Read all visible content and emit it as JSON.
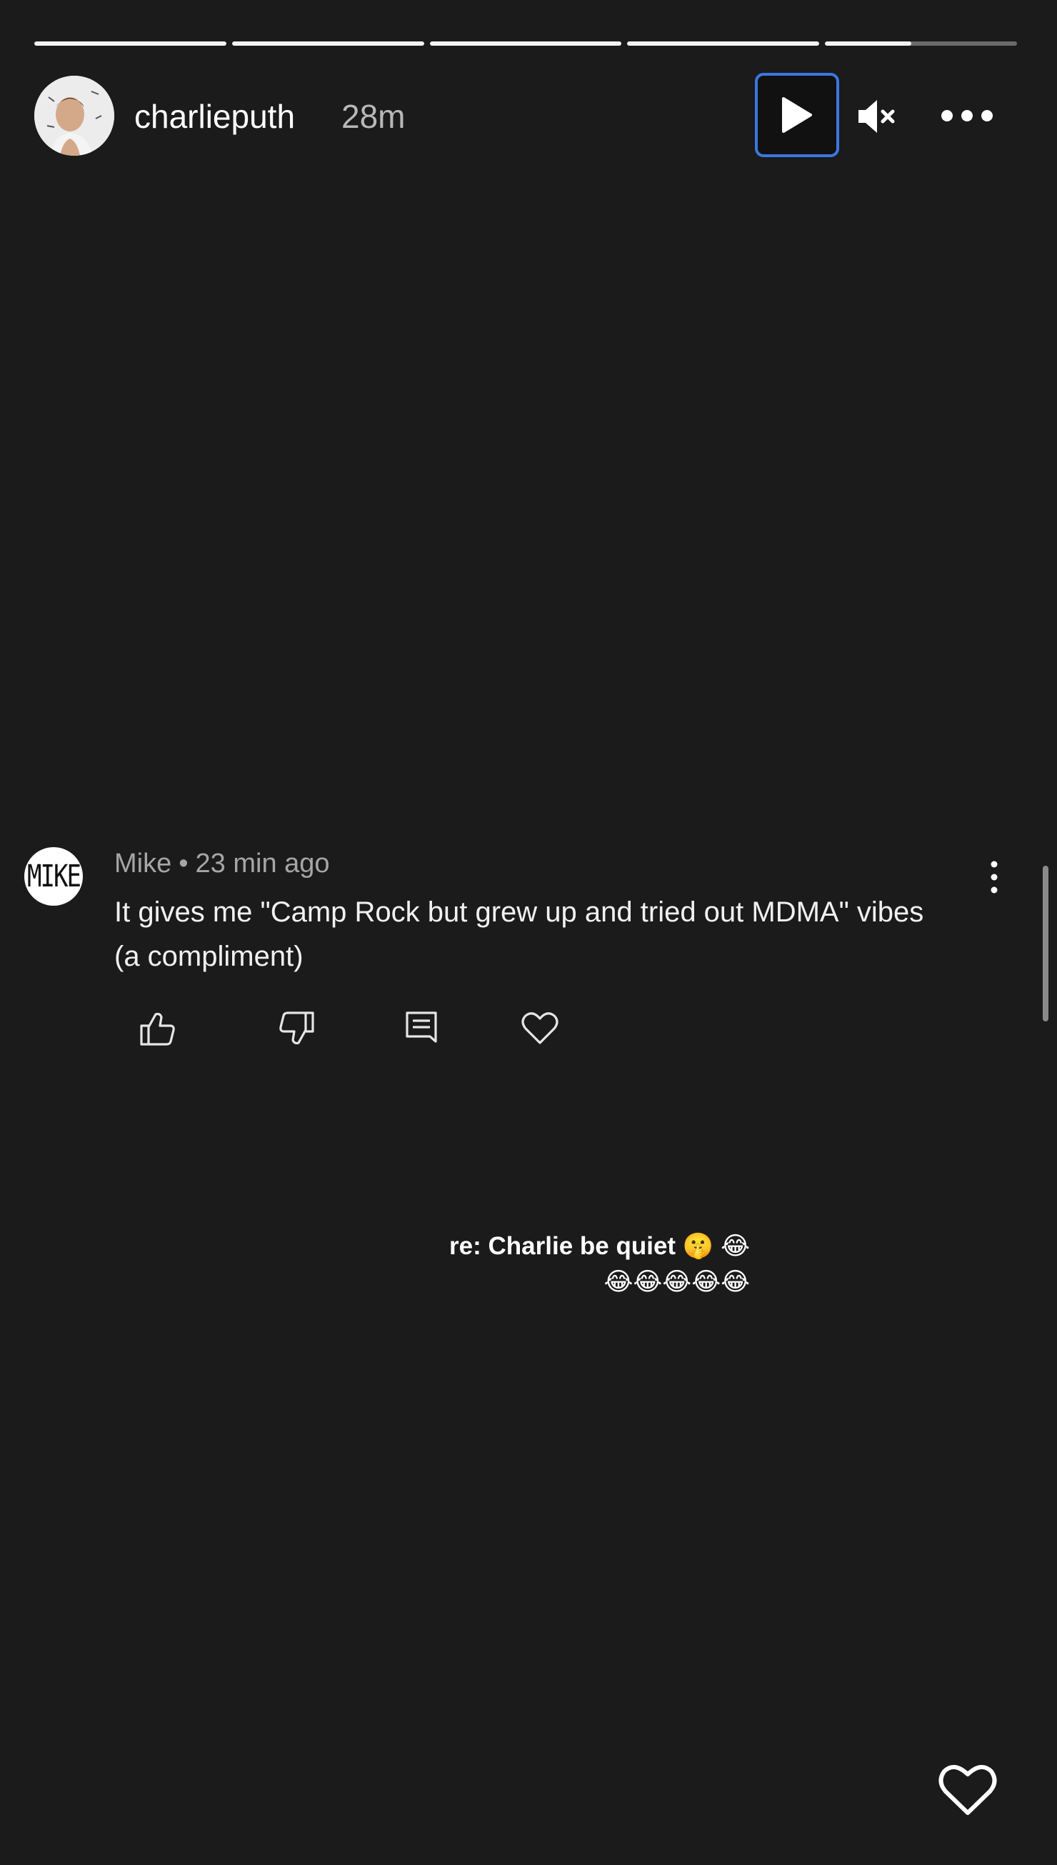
{
  "story": {
    "progress_segments": [
      1,
      1,
      1,
      1,
      0.45
    ],
    "username": "charlieputh",
    "time": "28m"
  },
  "controls": {
    "play_icon": "play-icon",
    "mute_icon": "speaker-muted-icon",
    "more_icon": "more-horizontal-icon",
    "accent_color": "#3a78e0"
  },
  "comment": {
    "avatar_text": "MIKE",
    "author": "Mike",
    "separator": "•",
    "time": "23 min ago",
    "text": "It gives me \"Camp Rock but grew up and tried out MDMA\" vibes (a compliment)",
    "actions": [
      "thumbs-up-icon",
      "thumbs-down-icon",
      "reply-icon",
      "heart-icon"
    ]
  },
  "reply_caption": {
    "line1": "re: Charlie be quiet 🤫 😂",
    "line2": "😂😂😂😂😂"
  },
  "footer": {
    "like_icon": "heart-outline-icon"
  }
}
